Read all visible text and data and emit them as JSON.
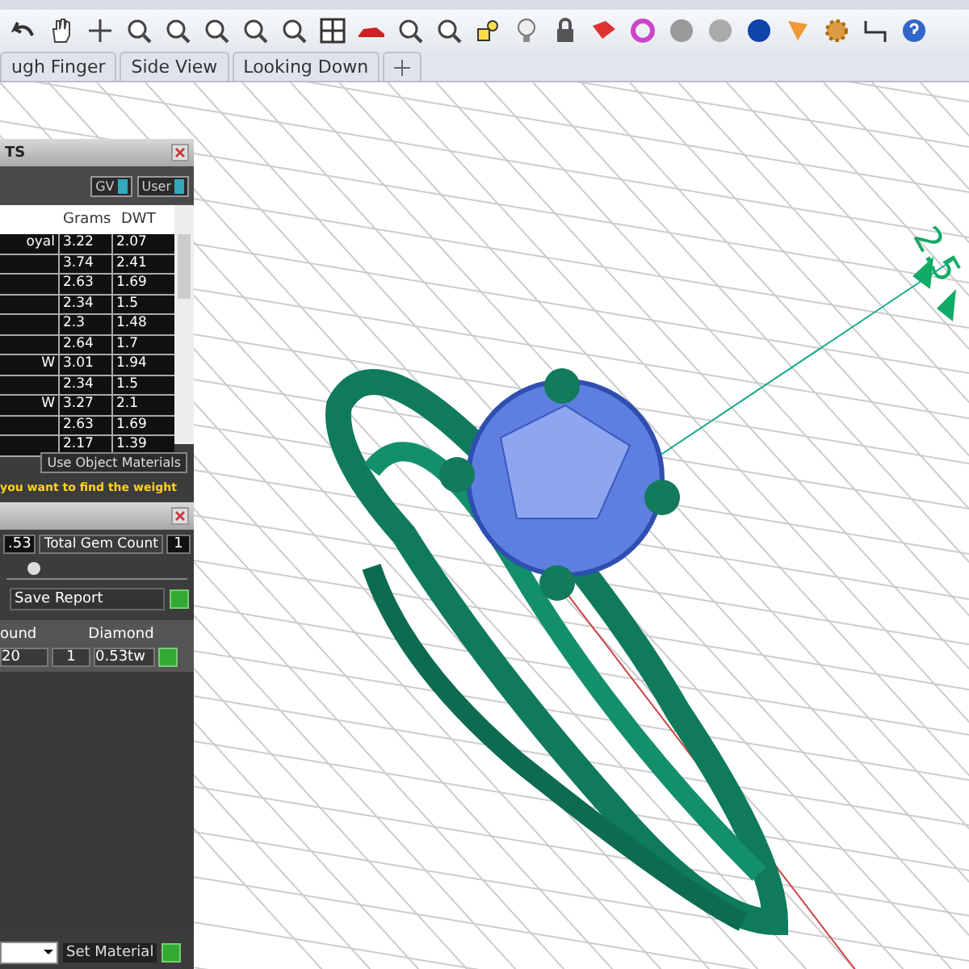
{
  "tabs": [
    {
      "label": "ugh Finger",
      "selected": false
    },
    {
      "label": "Side View",
      "selected": false
    },
    {
      "label": "Looking Down",
      "selected": false
    }
  ],
  "weights_panel": {
    "title": "TS",
    "toggles": [
      {
        "label": "GV",
        "on": true
      },
      {
        "label": "User",
        "on": true
      }
    ],
    "columns": [
      "Grams",
      "DWT"
    ],
    "rows": [
      {
        "name": "oyal",
        "grams": "3.22",
        "dwt": "2.07"
      },
      {
        "name": "",
        "grams": "3.74",
        "dwt": "2.41"
      },
      {
        "name": "",
        "grams": "2.63",
        "dwt": "1.69"
      },
      {
        "name": "",
        "grams": "2.34",
        "dwt": "1.5"
      },
      {
        "name": "",
        "grams": "2.3",
        "dwt": "1.48"
      },
      {
        "name": "",
        "grams": "2.64",
        "dwt": "1.7"
      },
      {
        "name": "W",
        "grams": "3.01",
        "dwt": "1.94"
      },
      {
        "name": "",
        "grams": "2.34",
        "dwt": "1.5"
      },
      {
        "name": "W",
        "grams": "3.27",
        "dwt": "2.1"
      },
      {
        "name": "",
        "grams": "2.63",
        "dwt": "1.69"
      },
      {
        "name": "",
        "grams": "2.17",
        "dwt": "1.39"
      }
    ],
    "materials_button": "Use Object Materials",
    "hint": "you want to find the weight"
  },
  "gem_panel": {
    "weight_value": ".53",
    "count_label": "Total Gem Count",
    "count_value": "1",
    "slider": {
      "level": 0.12
    },
    "save_button": "Save Report",
    "columns": [
      "ound",
      "Diamond"
    ],
    "row": {
      "size": "20",
      "qty": "1",
      "weight": "0.53tw"
    },
    "set_button": "Set Material"
  },
  "dimension": "2.5"
}
